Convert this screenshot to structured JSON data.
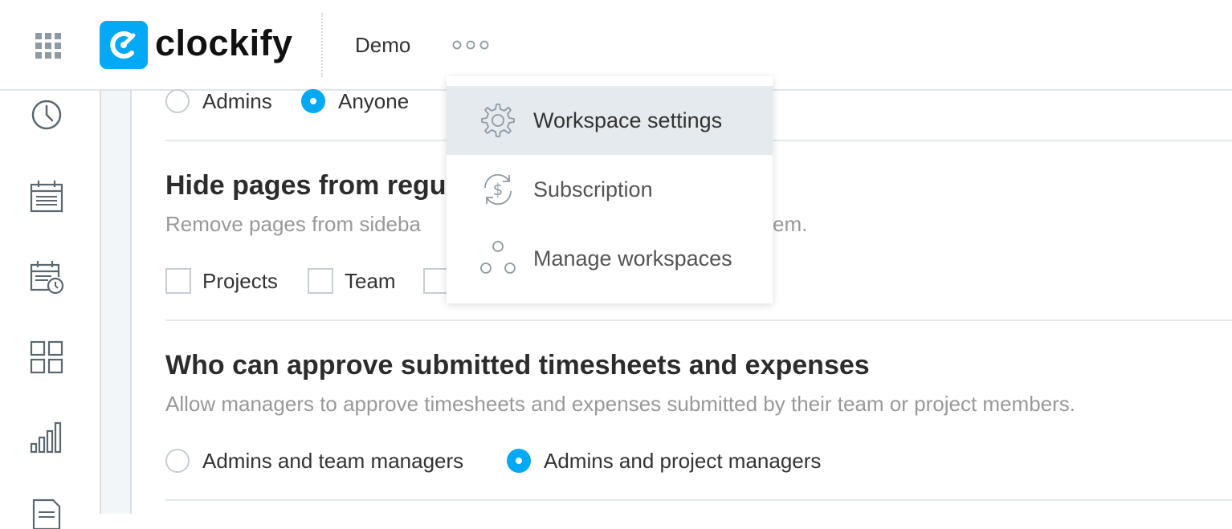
{
  "topbar": {
    "app_name": "clockify",
    "workspace": "Demo",
    "icons": [
      "apps-grid-icon",
      "clockify-logo",
      "more-options-icon"
    ]
  },
  "sidebar": {
    "icons": [
      "clock-icon",
      "calendar-icon",
      "calendar-clock-icon",
      "dashboard-icon",
      "reports-icon",
      "document-icon"
    ]
  },
  "sections": {
    "top_row": {
      "options": [
        {
          "label": "Admins",
          "selected": false
        },
        {
          "label": "Anyone",
          "selected": true
        }
      ]
    },
    "hide_pages": {
      "title": "Hide pages from regu",
      "description_left": "Remove pages from sideba",
      "description_right": "em.",
      "checkboxes": [
        {
          "label": "Projects",
          "checked": false
        },
        {
          "label": "Team",
          "checked": false
        }
      ]
    },
    "approve": {
      "title": "Who can approve submitted timesheets and expenses",
      "description": "Allow managers to approve timesheets and expenses submitted by their team or project members.",
      "options": [
        {
          "label": "Admins and team managers",
          "selected": false
        },
        {
          "label": "Admins and project managers",
          "selected": true
        }
      ]
    }
  },
  "dropdown": {
    "items": [
      {
        "label": "Workspace settings",
        "icon": "gear-icon",
        "active": true
      },
      {
        "label": "Subscription",
        "icon": "subscription-icon",
        "active": false
      },
      {
        "label": "Manage workspaces",
        "icon": "workspaces-icon",
        "active": false
      }
    ]
  },
  "colors": {
    "brand": "#03a9f4",
    "text": "#333333",
    "muted": "#999999",
    "border": "#d8dfe3",
    "menu_active": "#e4eaee"
  }
}
